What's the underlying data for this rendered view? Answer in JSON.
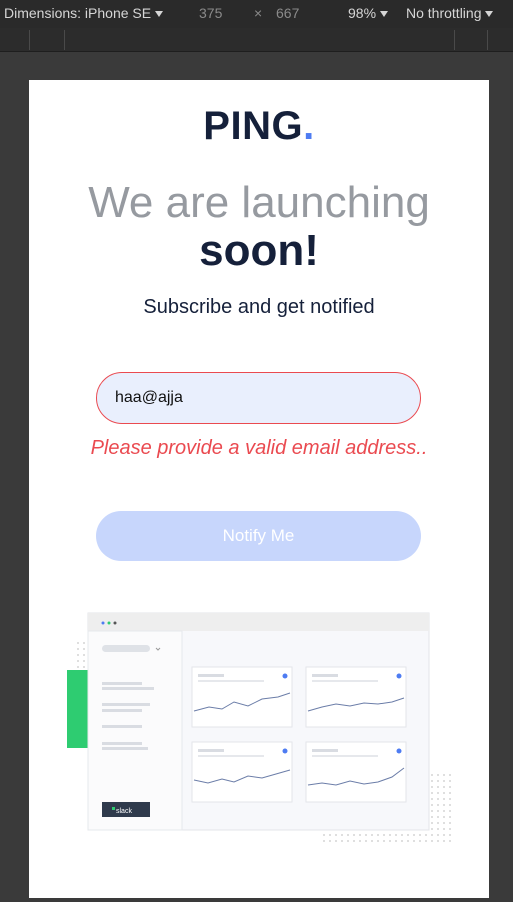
{
  "devtools": {
    "dimensions_label": "Dimensions: iPhone SE",
    "width": "375",
    "times": "×",
    "height": "667",
    "zoom": "98%",
    "throttle": "No throttling"
  },
  "page": {
    "logo_text": "PING",
    "logo_dot": ".",
    "headline_light": "We are launching",
    "headline_bold": "soon!",
    "subtitle": "Subscribe and get notified",
    "email_value": "haa@ajja",
    "error_message": "Please provide a valid email address..",
    "notify_label": "Notify Me",
    "dashboard_badge": "slack"
  },
  "colors": {
    "accent": "#4e7cf2",
    "error": "#ea4a50",
    "dark": "#15203a",
    "button_disabled": "#c7d6fc",
    "green_block": "#2ecc71"
  }
}
